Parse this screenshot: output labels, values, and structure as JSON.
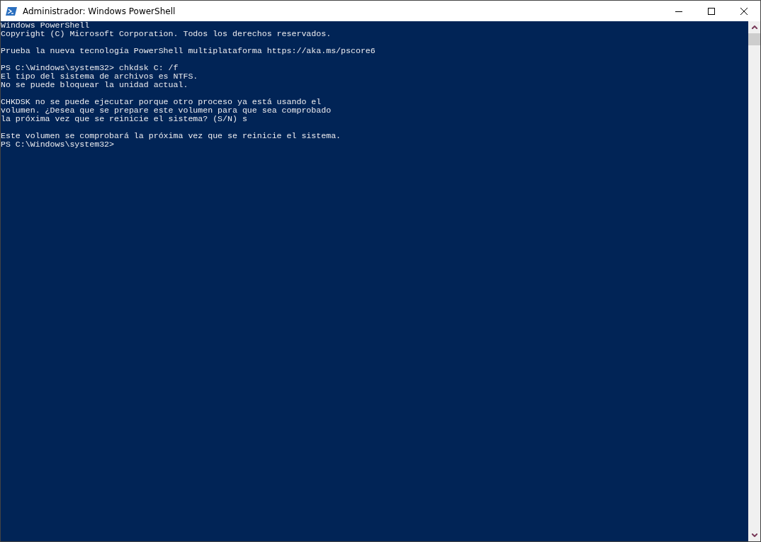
{
  "window": {
    "title": "Administrador: Windows PowerShell"
  },
  "console": {
    "paragraphs": [
      {
        "lines": [
          "Windows PowerShell",
          "Copyright (C) Microsoft Corporation. Todos los derechos reservados."
        ]
      },
      {
        "lines": [
          "Prueba la nueva tecnología PowerShell multiplataforma https://aka.ms/pscore6"
        ]
      },
      {
        "lines": [
          "PS C:\\Windows\\system32> chkdsk C: /f",
          "El tipo del sistema de archivos es NTFS.",
          "No se puede bloquear la unidad actual."
        ]
      },
      {
        "lines": [
          "CHKDSK no se puede ejecutar porque otro proceso ya está usando el",
          "volumen. ¿Desea que se prepare este volumen para que sea comprobado",
          "la próxima vez que se reinicie el sistema? (S/N) s"
        ]
      },
      {
        "lines": [
          "Este volumen se comprobará la próxima vez que se reinicie el sistema.",
          "PS C:\\Windows\\system32>"
        ]
      }
    ]
  }
}
